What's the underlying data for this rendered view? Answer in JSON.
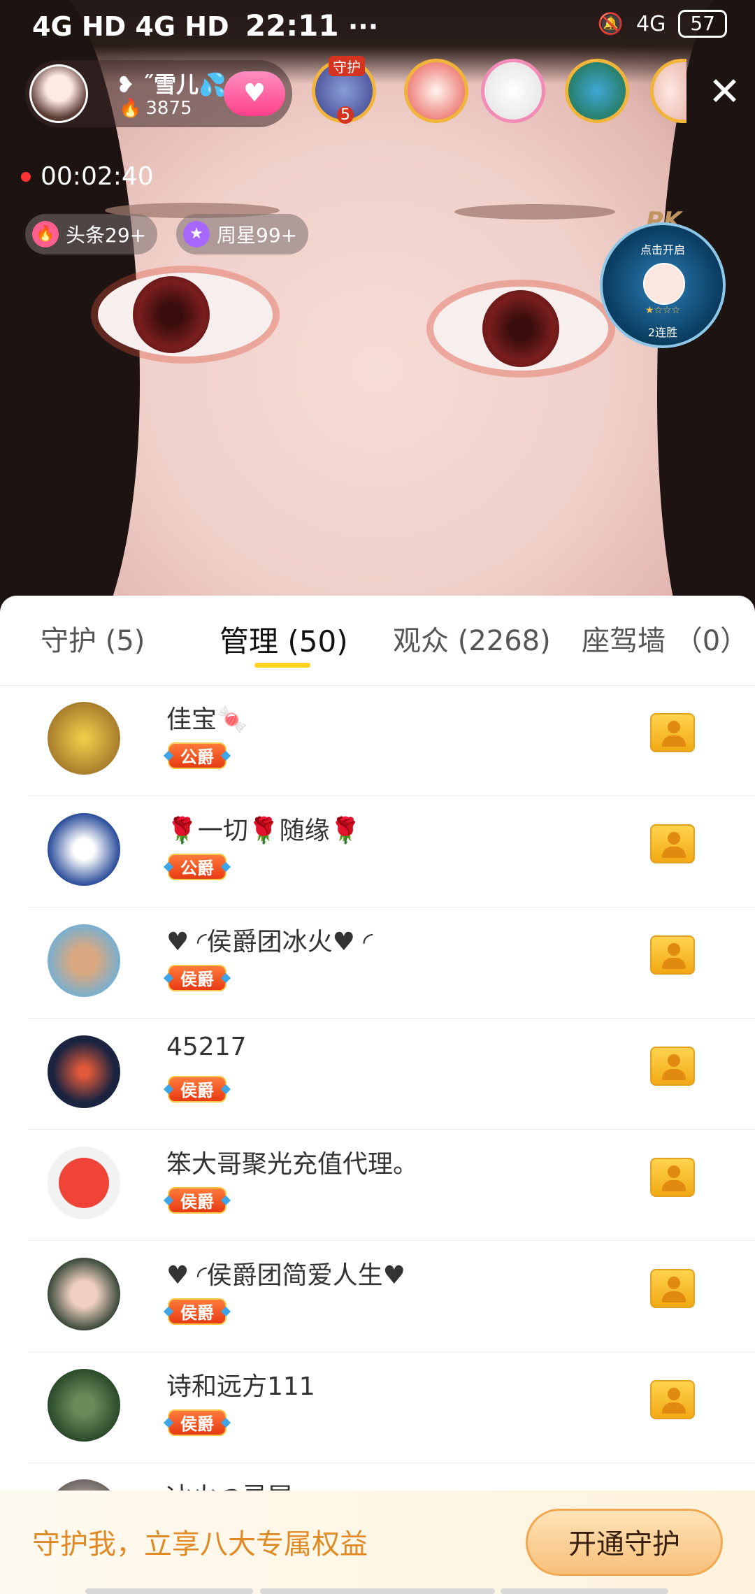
{
  "status_bar": {
    "network": "4G HD 4G HD",
    "time": "22:11",
    "dots": "···",
    "right_network": "4G",
    "battery": "57"
  },
  "host": {
    "name": "❥ ˝雪儿💦",
    "heat": "3875",
    "follow_icon": "heart-icon"
  },
  "live_timer": "00:02:40",
  "pills": {
    "headline": "头条29+",
    "weekly_star": "周星99+"
  },
  "guard_badge_level": "5",
  "guard_badge_label": "守护",
  "pk_widget": {
    "logo": "PK",
    "tip": "点击开启",
    "stars": "★☆☆☆",
    "wins": "2连胜"
  },
  "tabs": [
    {
      "label": "守护",
      "count": "(5)"
    },
    {
      "label": "管理",
      "count": "(50)"
    },
    {
      "label": "观众",
      "count": "(2268)"
    },
    {
      "label": "座驾墙",
      "count": "（0）"
    }
  ],
  "members": [
    {
      "name": "佳宝🍬",
      "rank": "公爵"
    },
    {
      "name": "🌹一切🌹随缘🌹",
      "rank": "公爵"
    },
    {
      "name": "♥ ◜侯爵团冰火♥ ◜",
      "rank": "侯爵"
    },
    {
      "name": "45217",
      "rank": "侯爵"
    },
    {
      "name": "笨大哥聚光充值代理。",
      "rank": "侯爵"
    },
    {
      "name": "♥ ◜侯爵团简爱人生♥",
      "rank": "侯爵"
    },
    {
      "name": "诗和远方111",
      "rank": "侯爵"
    }
  ],
  "partial_member_name": "冰火つ灵犀",
  "bottom_bar": {
    "promo": "守护我，立享八大专属权益",
    "button": "开通守护"
  },
  "colors": {
    "tab_underline": "#ffd21e",
    "promo_text": "#e08a25",
    "rank_badge": "#e83a14"
  }
}
